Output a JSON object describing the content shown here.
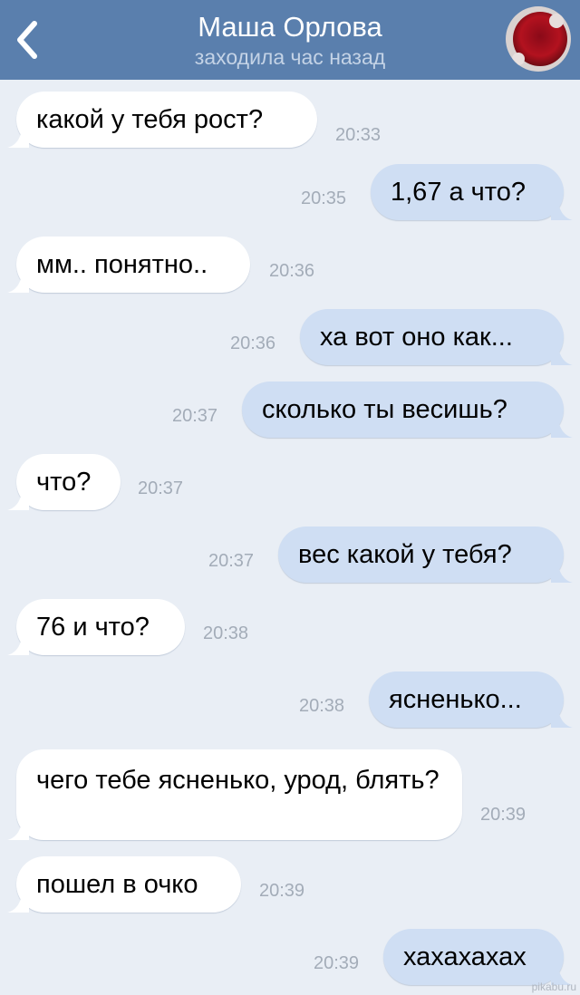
{
  "header": {
    "title": "Маша Орлова",
    "subtitle": "заходила час назад",
    "back_icon": "chevron-left-icon",
    "color": "#5a7fad"
  },
  "messages": [
    {
      "direction": "in",
      "text": "какой у тебя рост?",
      "time": "20:33"
    },
    {
      "direction": "out",
      "text": "1,67 а что?",
      "time": "20:35"
    },
    {
      "direction": "in",
      "text": "мм.. понятно..",
      "time": "20:36"
    },
    {
      "direction": "out",
      "text": "ха вот оно как...",
      "time": "20:36"
    },
    {
      "direction": "out",
      "text": "сколько ты весишь?",
      "time": "20:37"
    },
    {
      "direction": "in",
      "text": "что?",
      "time": "20:37"
    },
    {
      "direction": "out",
      "text": "вес какой у тебя?",
      "time": "20:37"
    },
    {
      "direction": "in",
      "text": "76 и что?",
      "time": "20:38"
    },
    {
      "direction": "out",
      "text": "ясненько...",
      "time": "20:38"
    },
    {
      "direction": "in",
      "text": "чего тебе ясненько, урод, блять?",
      "time": "20:39"
    },
    {
      "direction": "in",
      "text": "пошел в очко",
      "time": "20:39"
    },
    {
      "direction": "out",
      "text": "хахахахах",
      "time": "20:39"
    }
  ],
  "watermark": "pikabu.ru",
  "colors": {
    "incoming_bubble": "#ffffff",
    "outgoing_bubble": "#cfdef3",
    "background": "#e9eef5",
    "timestamp": "#a3acb8"
  }
}
